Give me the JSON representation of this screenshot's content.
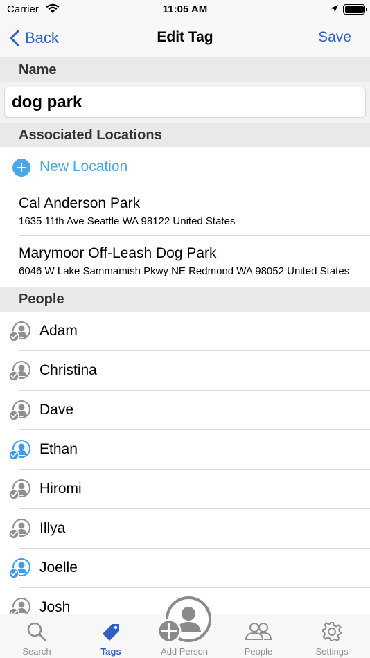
{
  "status_bar": {
    "carrier": "Carrier",
    "time": "11:05 AM",
    "wifi_icon": "wifi-icon",
    "location_icon": "location-arrow-icon",
    "battery_icon": "battery-icon"
  },
  "nav": {
    "back_label": "Back",
    "title": "Edit Tag",
    "save_label": "Save",
    "accent_color": "#2f5fc4"
  },
  "name_section": {
    "header": "Name",
    "value": "dog park"
  },
  "locations_section": {
    "header": "Associated Locations",
    "new_location_label": "New Location",
    "items": [
      {
        "title": "Cal Anderson Park",
        "address": "1635 11th Ave Seattle WA 98122 United States"
      },
      {
        "title": "Marymoor Off-Leash Dog Park",
        "address": "6046 W Lake Sammamish Pkwy NE Redmond WA 98052 United States"
      }
    ]
  },
  "people_section": {
    "header": "People",
    "items": [
      {
        "name": "Adam",
        "selected": false
      },
      {
        "name": "Christina",
        "selected": false
      },
      {
        "name": "Dave",
        "selected": false
      },
      {
        "name": "Ethan",
        "selected": true
      },
      {
        "name": "Hiromi",
        "selected": false
      },
      {
        "name": "Illya",
        "selected": false
      },
      {
        "name": "Joelle",
        "selected": true
      },
      {
        "name": "Josh",
        "selected": false
      }
    ],
    "selected_color": "#3d9be9",
    "unselected_color": "#8e8e93"
  },
  "tab_bar": {
    "tabs": [
      {
        "label": "Search",
        "icon": "search-icon",
        "active": false
      },
      {
        "label": "Tags",
        "icon": "tag-icon",
        "active": true
      },
      {
        "label": "Add Person",
        "icon": "add-person-icon",
        "active": false
      },
      {
        "label": "People",
        "icon": "people-icon",
        "active": false
      },
      {
        "label": "Settings",
        "icon": "gear-icon",
        "active": false
      }
    ]
  }
}
